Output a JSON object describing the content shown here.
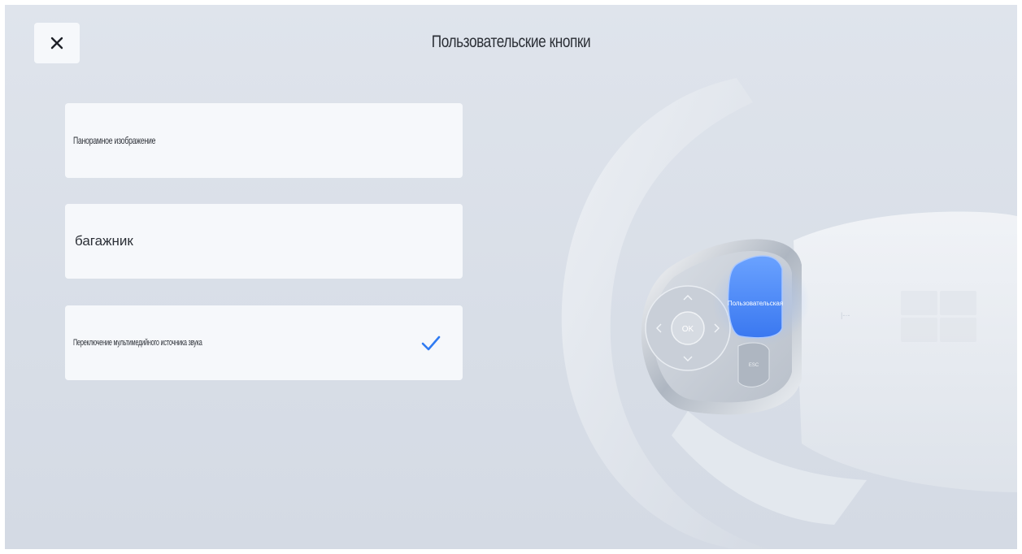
{
  "header": {
    "title": "Пользовательские кнопки",
    "close_icon": "close-icon"
  },
  "options": [
    {
      "label": "Панорамное изображение",
      "selected": false
    },
    {
      "label": "багажник",
      "selected": false
    },
    {
      "label": "Переключение мультимедийного источника звука",
      "selected": true
    }
  ],
  "wheel": {
    "custom_button_label": "Пользовательская",
    "ok_label": "OK",
    "lower_button_label": "ESC"
  },
  "colors": {
    "accent": "#2f7bf2",
    "highlight_button": "#4f8ff7",
    "background": "#dce1e9",
    "card": "#f6f8fb"
  }
}
